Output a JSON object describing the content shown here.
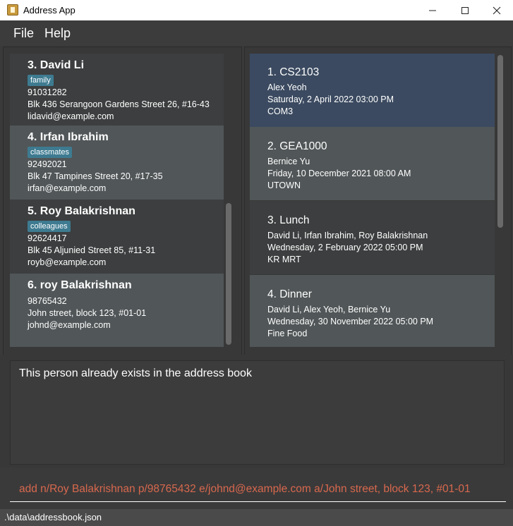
{
  "window": {
    "title": "Address App"
  },
  "menu": {
    "file": "File",
    "help": "Help"
  },
  "persons": [
    {
      "name": "3.  David Li",
      "tag": "family",
      "phone": "91031282",
      "address": "Blk 436 Serangoon Gardens Street 26, #16-43",
      "email": "lidavid@example.com"
    },
    {
      "name": "4.  Irfan Ibrahim",
      "tag": "classmates",
      "phone": "92492021",
      "address": "Blk 47 Tampines Street 20, #17-35",
      "email": "irfan@example.com"
    },
    {
      "name": "5.  Roy Balakrishnan",
      "tag": "colleagues",
      "phone": "92624417",
      "address": "Blk 45 Aljunied Street 85, #11-31",
      "email": "royb@example.com"
    },
    {
      "name": "6.  roy Balakrishnan",
      "phone": "98765432",
      "address": "John street, block 123, #01-01",
      "email": "johnd@example.com"
    }
  ],
  "events": [
    {
      "name": "1.  CS2103",
      "people": "Alex Yeoh",
      "time": "Saturday, 2 April 2022 03:00 PM",
      "location": "COM3"
    },
    {
      "name": "2.  GEA1000",
      "people": "Bernice Yu",
      "time": "Friday, 10 December 2021 08:00 AM",
      "location": "UTOWN"
    },
    {
      "name": "3.  Lunch",
      "people": "David Li, Irfan Ibrahim, Roy Balakrishnan",
      "time": "Wednesday, 2 February 2022 05:00 PM",
      "location": "KR MRT"
    },
    {
      "name": "4.  Dinner",
      "people": "David Li, Alex Yeoh, Bernice Yu",
      "time": "Wednesday, 30 November 2022 05:00 PM",
      "location": "Fine Food"
    }
  ],
  "result": {
    "message": "This person already exists in the address book"
  },
  "command": {
    "value": "add n/Roy Balakrishnan p/98765432 e/johnd@example.com a/John street, block 123, #01-01"
  },
  "status": {
    "path": ".\\data\\addressbook.json"
  }
}
